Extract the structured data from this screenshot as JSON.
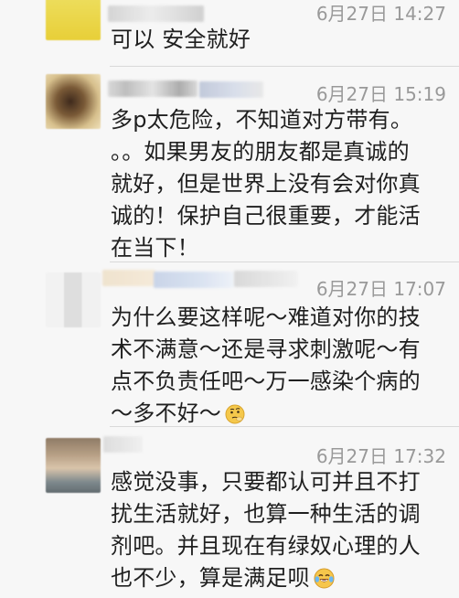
{
  "comments": [
    {
      "time": "6月27日 14:27",
      "lines": [
        "可以 安全就好"
      ]
    },
    {
      "time": "6月27日 15:19",
      "lines": [
        "多p太危险，不知道对方带有。",
        "。。如果男友的朋友都是真诚的",
        "就好，但是世界上没有会对你真",
        "诚的！保护自己很重要，才能活",
        "在当下！"
      ]
    },
    {
      "time": "6月27日 17:07",
      "lines": [
        "为什么要这样呢～难道对你的技",
        "术不满意～还是寻求刺激呢～有",
        "点不负责任吧～万一感染个病的",
        "～多不好～"
      ],
      "trailing_emoji": "thinking-face-emoji"
    },
    {
      "time": "6月27日 17:32",
      "lines": [
        "感觉没事，只要都认可并且不打",
        "扰生活就好，也算一种生活的调",
        "剂吧。并且现在有绿奴心理的人",
        "也不少，算是满足呗"
      ],
      "trailing_emoji": "tears-of-joy-emoji"
    }
  ],
  "colors": {
    "background": "#f7f7f7",
    "text": "#1f1f1f",
    "timestamp": "#999999",
    "divider": "#d9d9d9"
  }
}
